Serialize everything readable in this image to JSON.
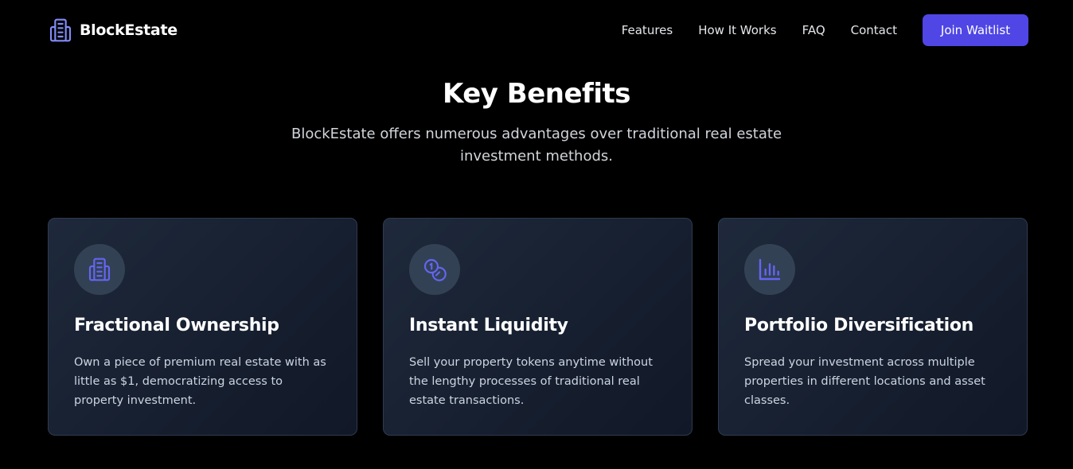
{
  "brand": {
    "name": "BlockEstate",
    "icon": "building-icon",
    "accent_color": "#818cf8"
  },
  "nav": {
    "links": [
      {
        "label": "Features"
      },
      {
        "label": "How It Works"
      },
      {
        "label": "FAQ"
      },
      {
        "label": "Contact"
      }
    ],
    "cta_label": "Join Waitlist",
    "cta_color": "#4f46e5"
  },
  "section": {
    "title": "Key Benefits",
    "subtitle": "BlockEstate offers numerous advantages over traditional real estate investment methods."
  },
  "cards": [
    {
      "icon": "building-icon",
      "title": "Fractional Ownership",
      "description": "Own a piece of premium real estate with as little as $1, democratizing access to property investment."
    },
    {
      "icon": "coins-icon",
      "title": "Instant Liquidity",
      "description": "Sell your property tokens anytime without the lengthy processes of traditional real estate transactions."
    },
    {
      "icon": "bar-chart-icon",
      "title": "Portfolio Diversification",
      "description": "Spread your investment across multiple properties in different locations and asset classes."
    }
  ],
  "colors": {
    "background": "#000000",
    "card_background": "#1e293b",
    "icon_circle": "#334155",
    "icon_stroke": "#6366f1"
  }
}
